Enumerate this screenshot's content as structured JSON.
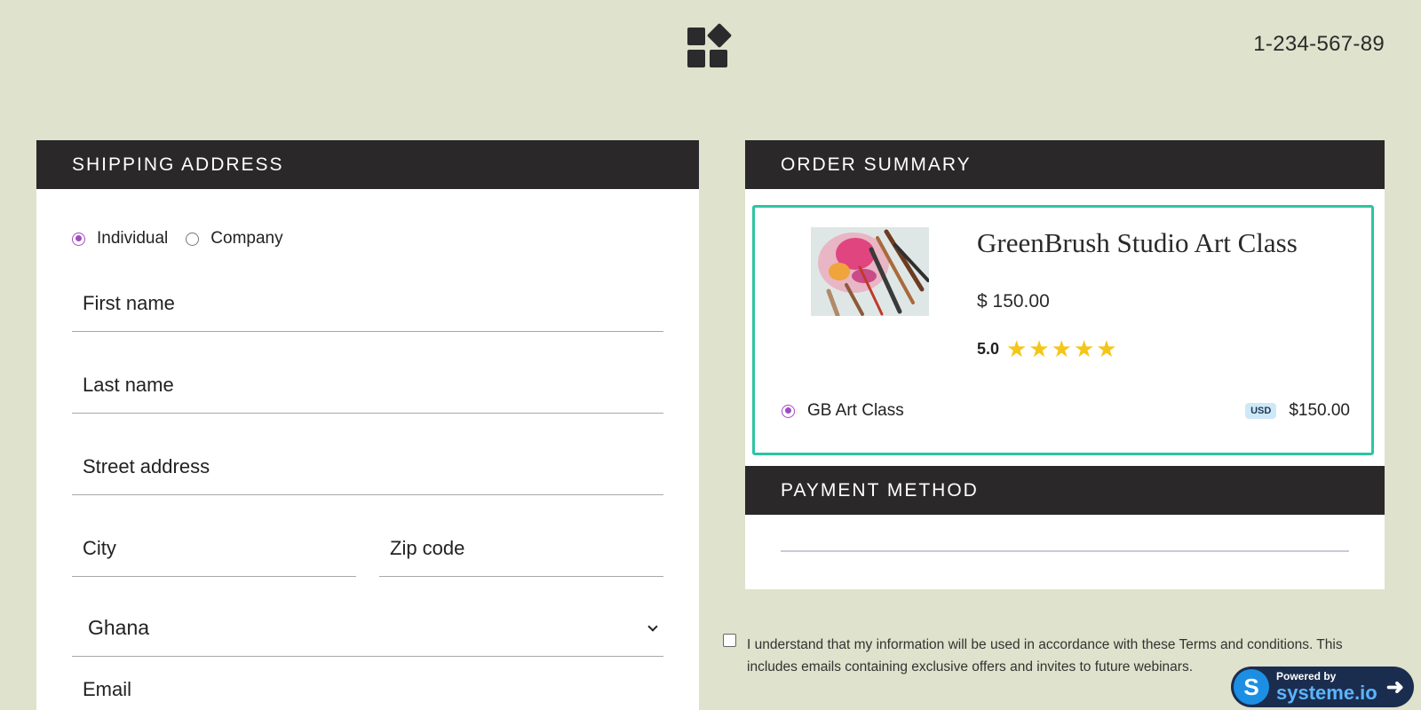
{
  "header": {
    "logo_icon": "grid-diamond-logo-icon",
    "phone": "1-234-567-89"
  },
  "shipping": {
    "title": "SHIPPING ADDRESS",
    "type_options": [
      {
        "label": "Individual",
        "selected": true
      },
      {
        "label": "Company",
        "selected": false
      }
    ],
    "fields": {
      "first_name": "First name",
      "last_name": "Last name",
      "street": "Street address",
      "city": "City",
      "zip": "Zip code",
      "country": "Ghana",
      "email": "Email"
    }
  },
  "order": {
    "title": "ORDER SUMMARY",
    "product_title": "GreenBrush Studio Art Class",
    "product_price": "$ 150.00",
    "rating": "5.0",
    "rating_stars": 5,
    "plan_name": "GB Art Class",
    "currency_badge": "USD",
    "plan_price": "$150.00",
    "accent_color": "#2ec4a2"
  },
  "payment": {
    "title": "PAYMENT METHOD"
  },
  "terms": {
    "text": "I understand that my information will be used in accordance with these Terms and conditions. This includes emails containing exclusive offers and invites to future webinars."
  },
  "powered": {
    "by": "Powered by",
    "brand": "systeme.io"
  }
}
